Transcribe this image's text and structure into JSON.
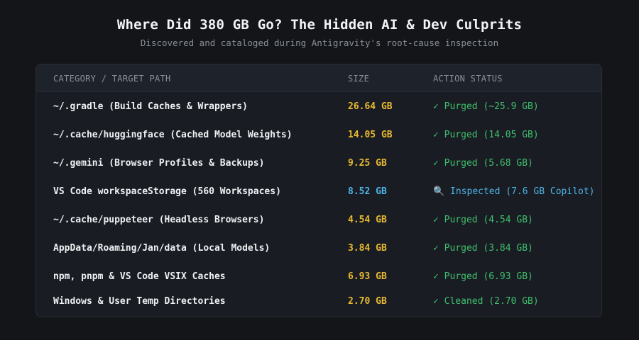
{
  "header": {
    "title": "Where Did 380 GB Go? The Hidden AI & Dev Culprits",
    "subtitle": "Discovered and cataloged during Antigravity's root-cause inspection"
  },
  "table": {
    "columns": [
      "CATEGORY / TARGET PATH",
      "SIZE",
      "ACTION STATUS"
    ],
    "rows": [
      {
        "path": "~/.gradle (Build Caches & Wrappers)",
        "size": "26.64 GB",
        "status": "✓ Purged (~25.9 GB)",
        "size_color": "#e8b931",
        "status_color": "#3fbf6e"
      },
      {
        "path": "~/.cache/huggingface (Cached Model Weights)",
        "size": "14.05 GB",
        "status": "✓ Purged (14.05 GB)",
        "size_color": "#e8b931",
        "status_color": "#3fbf6e"
      },
      {
        "path": "~/.gemini (Browser Profiles & Backups)",
        "size": "9.25 GB",
        "status": "✓ Purged (5.68 GB)",
        "size_color": "#e8b931",
        "status_color": "#3fbf6e"
      },
      {
        "path": "VS Code workspaceStorage (560 Workspaces)",
        "size": "8.52 GB",
        "status": "🔍 Inspected (7.6 GB Copilot)",
        "size_color": "#4db4e8",
        "status_color": "#4db4e8"
      },
      {
        "path": "~/.cache/puppeteer (Headless Browsers)",
        "size": "4.54 GB",
        "status": "✓ Purged (4.54 GB)",
        "size_color": "#e8b931",
        "status_color": "#3fbf6e"
      },
      {
        "path": "AppData/Roaming/Jan/data (Local Models)",
        "size": "3.84 GB",
        "status": "✓ Purged (3.84 GB)",
        "size_color": "#e8b931",
        "status_color": "#3fbf6e"
      },
      {
        "path": "npm, pnpm & VS Code VSIX Caches",
        "size": "6.93 GB",
        "status": "✓ Purged (6.93 GB)",
        "size_color": "#e8b931",
        "status_color": "#3fbf6e"
      },
      {
        "path": "Windows & User Temp Directories",
        "size": "2.70 GB",
        "status": "✓ Cleaned (2.70 GB)",
        "size_color": "#e8b931",
        "status_color": "#3fbf6e"
      }
    ]
  }
}
